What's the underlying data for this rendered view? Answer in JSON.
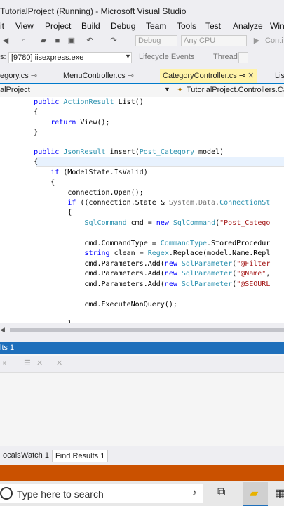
{
  "window": {
    "title": "TutorialProject (Running) - Microsoft Visual Studio"
  },
  "menu": [
    "it",
    "View",
    "Project",
    "Build",
    "Debug",
    "Team",
    "Tools",
    "Test",
    "Analyze",
    "Win"
  ],
  "toolbar": {
    "config": "Debug",
    "platform": "Any CPU",
    "continue": "Conti",
    "process": "[9780] iisexpress.exe",
    "lifecycle": "Lifecycle Events",
    "thread": "Thread:"
  },
  "tabs": [
    "egory.cs",
    "MenuController.cs",
    "CategoryController.cs",
    "Lis"
  ],
  "nav": {
    "project": "alProject",
    "type": "TutorialProject.Controllers.Ca"
  },
  "code": [
    {
      "t": "        public ActionResult List()"
    },
    {
      "t": "        {"
    },
    {
      "t": "            return View();"
    },
    {
      "t": "        }"
    },
    {
      "t": ""
    },
    {
      "t": "        public JsonResult insert(Post_Category model)"
    },
    {
      "t": "        {"
    },
    {
      "t": "            if (ModelState.IsValid)"
    },
    {
      "t": "            {"
    },
    {
      "t": "                connection.Open();"
    },
    {
      "t": "                if ((connection.State & System.Data.ConnectionSt"
    },
    {
      "t": "                {"
    },
    {
      "t": "                    SqlCommand cmd = new SqlCommand(\"Post_Catego"
    },
    {
      "t": ""
    },
    {
      "t": "                    cmd.CommandType = CommandType.StoredProcedur"
    },
    {
      "t": "                    string clean = Regex.Replace(model.Name.Repl"
    },
    {
      "t": "                    cmd.Parameters.Add(new SqlParameter(\"@Filter"
    },
    {
      "t": "                    cmd.Parameters.Add(new SqlParameter(\"@Name\","
    },
    {
      "t": "                    cmd.Parameters.Add(new SqlParameter(\"@SEOURL"
    },
    {
      "t": ""
    },
    {
      "t": "                    cmd.ExecuteNonQuery();"
    },
    {
      "t": ""
    },
    {
      "t": "                }"
    }
  ],
  "panel": {
    "title": "lts 1"
  },
  "bottomTabs": [
    "ocals",
    "Watch 1",
    "Find Results 1"
  ],
  "taskbar": {
    "search_placeholder": "Type here to search"
  }
}
